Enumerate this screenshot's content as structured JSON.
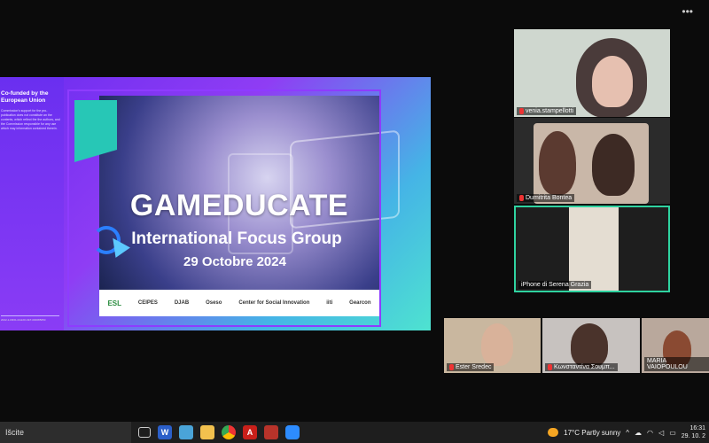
{
  "window": {
    "more_menu": "•••"
  },
  "slide": {
    "eu_title": "Co-funded by the European Union",
    "eu_disclaimer": "Commission's support for the pro- publication does not constitute an the contents, which reflect the the authors, and the Commission responsible for any use which may information contained therein.",
    "footer": "2022-1-FR01-KA220-VET-000085050",
    "title": "GAMEDUCATE",
    "subtitle": "International Focus Group",
    "date": "29 Octobre 2024",
    "logos": [
      "ESL",
      "CEIPES",
      "DJAB",
      "Oseso",
      "Center for Social Innovation",
      "iiti",
      "Gearcon"
    ]
  },
  "participants": [
    {
      "name": "venia.stampellotti"
    },
    {
      "name": "Dumitrita Bontea"
    },
    {
      "name": "iPhone di Serena Grazia"
    },
    {
      "name": "Ester Sredec"
    },
    {
      "name": "Κωνσταντίνα Σουμπ..."
    },
    {
      "name": "MARIA VAIOPOULOU"
    }
  ],
  "taskbar": {
    "search_text": "Išcite",
    "weather": "17°C  Partly sunny",
    "time": "16:31",
    "date": "29. 10. 2"
  },
  "colors": {
    "accent": "#2fd3a0",
    "slide_purple": "#6b2cf0",
    "slide_teal": "#4ee3d0"
  }
}
